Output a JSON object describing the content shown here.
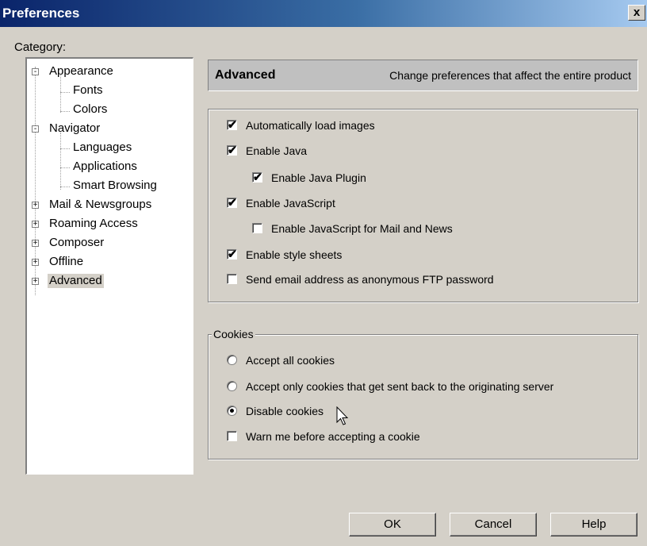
{
  "window": {
    "title": "Preferences",
    "close_label": "x"
  },
  "category": {
    "label": "Category:",
    "items": [
      {
        "label": "Appearance",
        "expander": "-"
      },
      {
        "label": "Fonts"
      },
      {
        "label": "Colors"
      },
      {
        "label": "Navigator",
        "expander": "-"
      },
      {
        "label": "Languages"
      },
      {
        "label": "Applications"
      },
      {
        "label": "Smart Browsing"
      },
      {
        "label": "Mail & Newsgroups",
        "expander": "+"
      },
      {
        "label": "Roaming Access",
        "expander": "+"
      },
      {
        "label": "Composer",
        "expander": "+"
      },
      {
        "label": "Offline",
        "expander": "+"
      },
      {
        "label": "Advanced",
        "expander": "+",
        "selected": true
      }
    ]
  },
  "header": {
    "title": "Advanced",
    "description": "Change preferences that affect the entire product"
  },
  "options": [
    {
      "label": "Automatically load images",
      "checked": true
    },
    {
      "label": "Enable Java",
      "checked": true
    },
    {
      "label": "Enable Java Plugin",
      "checked": true
    },
    {
      "label": "Enable JavaScript",
      "checked": true
    },
    {
      "label": "Enable JavaScript for Mail and News",
      "checked": false
    },
    {
      "label": "Enable style sheets",
      "checked": true
    },
    {
      "label": "Send email address as anonymous FTP password",
      "checked": false
    }
  ],
  "cookies": {
    "legend": "Cookies",
    "radios": [
      {
        "label": "Accept all cookies",
        "selected": false
      },
      {
        "label": "Accept only cookies that get sent back to the originating server",
        "selected": false
      },
      {
        "label": "Disable cookies",
        "selected": true
      }
    ],
    "warn": {
      "label": "Warn me before accepting a cookie",
      "checked": false
    }
  },
  "buttons": {
    "ok": "OK",
    "cancel": "Cancel",
    "help": "Help"
  },
  "icons": {
    "checkmark": "✔",
    "cursor": "mouse-pointer-icon"
  }
}
